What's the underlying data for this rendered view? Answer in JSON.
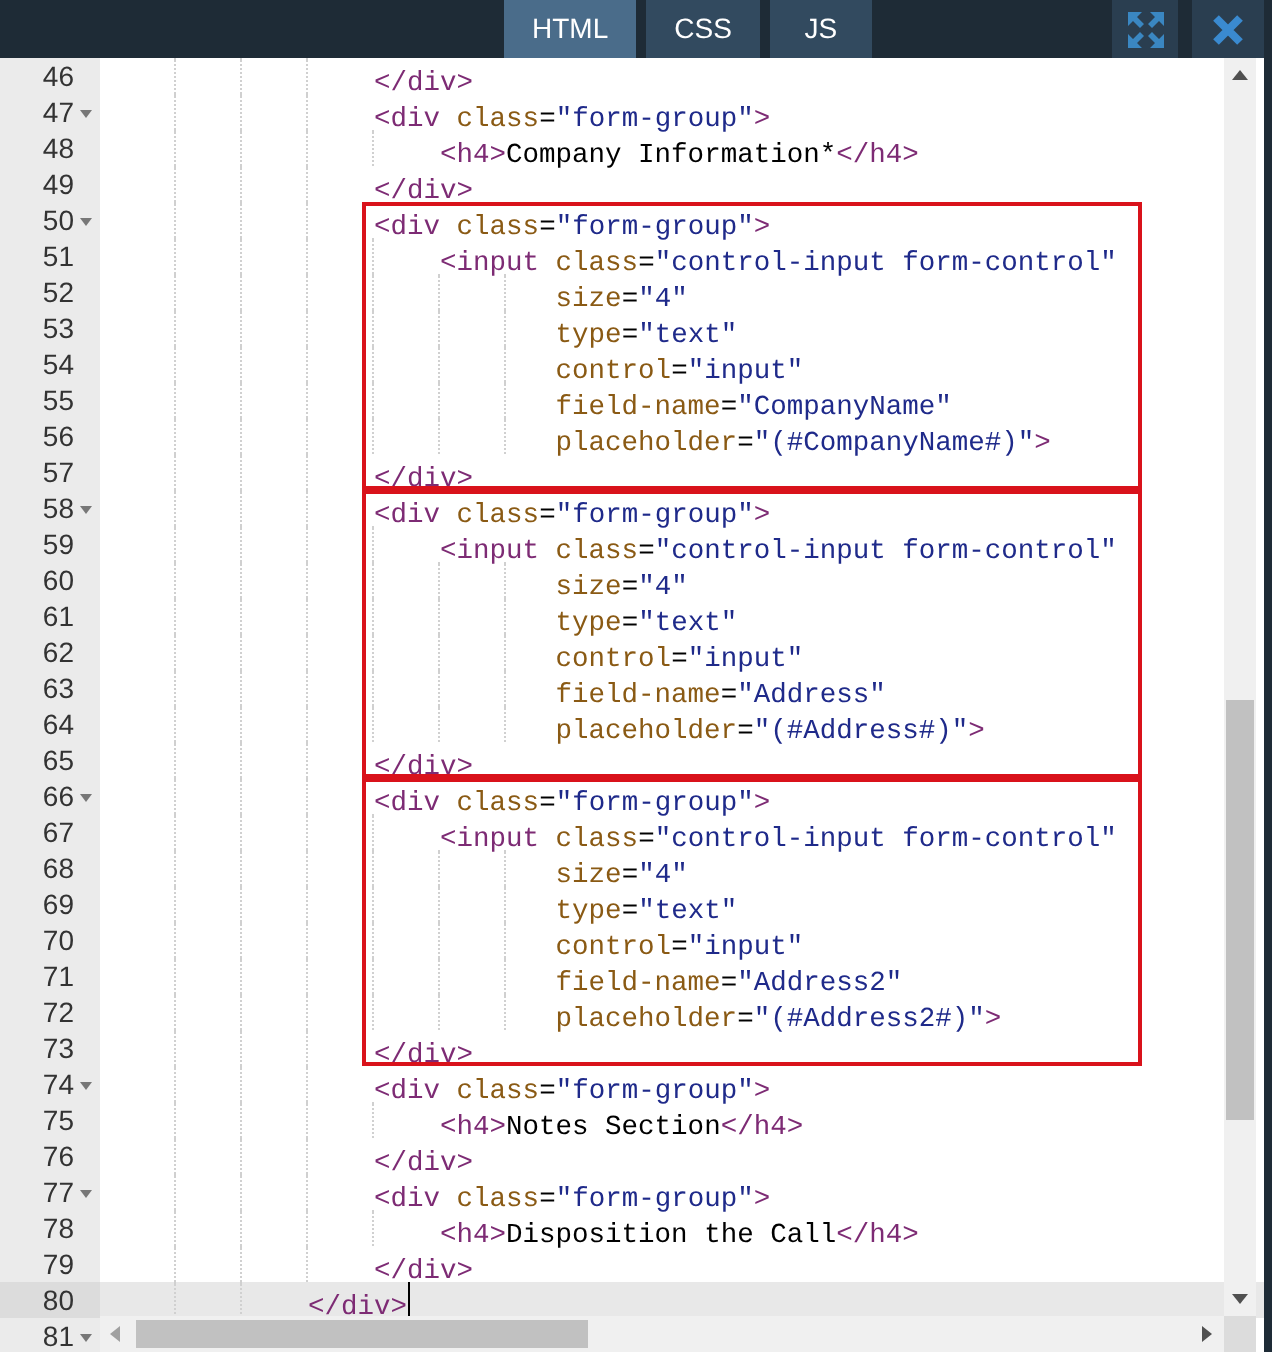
{
  "tabs": [
    {
      "label": "HTML",
      "selected": true
    },
    {
      "label": "CSS",
      "selected": false
    },
    {
      "label": "JS",
      "selected": false
    }
  ],
  "editor": {
    "blocks": [
      {
        "highlighted": false,
        "lines": [
          {
            "number": "46",
            "foldable": false,
            "active": false,
            "tokens": [
              {
                "kind": "tag",
                "text": "                </div>"
              }
            ]
          },
          {
            "number": "47",
            "foldable": true,
            "active": false,
            "tokens": [
              {
                "kind": "tag",
                "text": "                <div "
              },
              {
                "kind": "attr",
                "text": "class"
              },
              {
                "kind": "text",
                "text": "="
              },
              {
                "kind": "string",
                "text": "\"form-group\""
              },
              {
                "kind": "tag",
                "text": ">"
              }
            ]
          },
          {
            "number": "48",
            "foldable": false,
            "active": false,
            "tokens": [
              {
                "kind": "tag",
                "text": "                    <h4>"
              },
              {
                "kind": "text",
                "text": "Company Information*"
              },
              {
                "kind": "tag",
                "text": "</h4>"
              }
            ]
          },
          {
            "number": "49",
            "foldable": false,
            "active": false,
            "tokens": [
              {
                "kind": "tag",
                "text": "                </div>"
              }
            ]
          }
        ]
      },
      {
        "highlighted": true,
        "lines": [
          {
            "number": "50",
            "foldable": true,
            "active": false,
            "tokens": [
              {
                "kind": "tag",
                "text": "                <div "
              },
              {
                "kind": "attr",
                "text": "class"
              },
              {
                "kind": "text",
                "text": "="
              },
              {
                "kind": "string",
                "text": "\"form-group\""
              },
              {
                "kind": "tag",
                "text": ">"
              }
            ]
          },
          {
            "number": "51",
            "foldable": false,
            "active": false,
            "tokens": [
              {
                "kind": "tag",
                "text": "                    <input "
              },
              {
                "kind": "attr",
                "text": "class"
              },
              {
                "kind": "text",
                "text": "="
              },
              {
                "kind": "string",
                "text": "\"control-input form-control\""
              }
            ]
          },
          {
            "number": "52",
            "foldable": false,
            "active": false,
            "tokens": [
              {
                "kind": "attr",
                "text": "                           size"
              },
              {
                "kind": "text",
                "text": "="
              },
              {
                "kind": "string",
                "text": "\"4\""
              }
            ]
          },
          {
            "number": "53",
            "foldable": false,
            "active": false,
            "tokens": [
              {
                "kind": "attr",
                "text": "                           type"
              },
              {
                "kind": "text",
                "text": "="
              },
              {
                "kind": "string",
                "text": "\"text\""
              }
            ]
          },
          {
            "number": "54",
            "foldable": false,
            "active": false,
            "tokens": [
              {
                "kind": "attr",
                "text": "                           control"
              },
              {
                "kind": "text",
                "text": "="
              },
              {
                "kind": "string",
                "text": "\"input\""
              }
            ]
          },
          {
            "number": "55",
            "foldable": false,
            "active": false,
            "tokens": [
              {
                "kind": "attr",
                "text": "                           field-name"
              },
              {
                "kind": "text",
                "text": "="
              },
              {
                "kind": "string",
                "text": "\"CompanyName\""
              }
            ]
          },
          {
            "number": "56",
            "foldable": false,
            "active": false,
            "tokens": [
              {
                "kind": "attr",
                "text": "                           placeholder"
              },
              {
                "kind": "text",
                "text": "="
              },
              {
                "kind": "string",
                "text": "\"(#CompanyName#)\""
              },
              {
                "kind": "tag",
                "text": ">"
              }
            ]
          },
          {
            "number": "57",
            "foldable": false,
            "active": false,
            "tokens": [
              {
                "kind": "tag",
                "text": "                </div>"
              }
            ]
          }
        ]
      },
      {
        "highlighted": true,
        "lines": [
          {
            "number": "58",
            "foldable": true,
            "active": false,
            "tokens": [
              {
                "kind": "tag",
                "text": "                <div "
              },
              {
                "kind": "attr",
                "text": "class"
              },
              {
                "kind": "text",
                "text": "="
              },
              {
                "kind": "string",
                "text": "\"form-group\""
              },
              {
                "kind": "tag",
                "text": ">"
              }
            ]
          },
          {
            "number": "59",
            "foldable": false,
            "active": false,
            "tokens": [
              {
                "kind": "tag",
                "text": "                    <input "
              },
              {
                "kind": "attr",
                "text": "class"
              },
              {
                "kind": "text",
                "text": "="
              },
              {
                "kind": "string",
                "text": "\"control-input form-control\""
              }
            ]
          },
          {
            "number": "60",
            "foldable": false,
            "active": false,
            "tokens": [
              {
                "kind": "attr",
                "text": "                           size"
              },
              {
                "kind": "text",
                "text": "="
              },
              {
                "kind": "string",
                "text": "\"4\""
              }
            ]
          },
          {
            "number": "61",
            "foldable": false,
            "active": false,
            "tokens": [
              {
                "kind": "attr",
                "text": "                           type"
              },
              {
                "kind": "text",
                "text": "="
              },
              {
                "kind": "string",
                "text": "\"text\""
              }
            ]
          },
          {
            "number": "62",
            "foldable": false,
            "active": false,
            "tokens": [
              {
                "kind": "attr",
                "text": "                           control"
              },
              {
                "kind": "text",
                "text": "="
              },
              {
                "kind": "string",
                "text": "\"input\""
              }
            ]
          },
          {
            "number": "63",
            "foldable": false,
            "active": false,
            "tokens": [
              {
                "kind": "attr",
                "text": "                           field-name"
              },
              {
                "kind": "text",
                "text": "="
              },
              {
                "kind": "string",
                "text": "\"Address\""
              }
            ]
          },
          {
            "number": "64",
            "foldable": false,
            "active": false,
            "tokens": [
              {
                "kind": "attr",
                "text": "                           placeholder"
              },
              {
                "kind": "text",
                "text": "="
              },
              {
                "kind": "string",
                "text": "\"(#Address#)\""
              },
              {
                "kind": "tag",
                "text": ">"
              }
            ]
          },
          {
            "number": "65",
            "foldable": false,
            "active": false,
            "tokens": [
              {
                "kind": "tag",
                "text": "                </div>"
              }
            ]
          }
        ]
      },
      {
        "highlighted": true,
        "lines": [
          {
            "number": "66",
            "foldable": true,
            "active": false,
            "tokens": [
              {
                "kind": "tag",
                "text": "                <div "
              },
              {
                "kind": "attr",
                "text": "class"
              },
              {
                "kind": "text",
                "text": "="
              },
              {
                "kind": "string",
                "text": "\"form-group\""
              },
              {
                "kind": "tag",
                "text": ">"
              }
            ]
          },
          {
            "number": "67",
            "foldable": false,
            "active": false,
            "tokens": [
              {
                "kind": "tag",
                "text": "                    <input "
              },
              {
                "kind": "attr",
                "text": "class"
              },
              {
                "kind": "text",
                "text": "="
              },
              {
                "kind": "string",
                "text": "\"control-input form-control\""
              }
            ]
          },
          {
            "number": "68",
            "foldable": false,
            "active": false,
            "tokens": [
              {
                "kind": "attr",
                "text": "                           size"
              },
              {
                "kind": "text",
                "text": "="
              },
              {
                "kind": "string",
                "text": "\"4\""
              }
            ]
          },
          {
            "number": "69",
            "foldable": false,
            "active": false,
            "tokens": [
              {
                "kind": "attr",
                "text": "                           type"
              },
              {
                "kind": "text",
                "text": "="
              },
              {
                "kind": "string",
                "text": "\"text\""
              }
            ]
          },
          {
            "number": "70",
            "foldable": false,
            "active": false,
            "tokens": [
              {
                "kind": "attr",
                "text": "                           control"
              },
              {
                "kind": "text",
                "text": "="
              },
              {
                "kind": "string",
                "text": "\"input\""
              }
            ]
          },
          {
            "number": "71",
            "foldable": false,
            "active": false,
            "tokens": [
              {
                "kind": "attr",
                "text": "                           field-name"
              },
              {
                "kind": "text",
                "text": "="
              },
              {
                "kind": "string",
                "text": "\"Address2\""
              }
            ]
          },
          {
            "number": "72",
            "foldable": false,
            "active": false,
            "tokens": [
              {
                "kind": "attr",
                "text": "                           placeholder"
              },
              {
                "kind": "text",
                "text": "="
              },
              {
                "kind": "string",
                "text": "\"(#Address2#)\""
              },
              {
                "kind": "tag",
                "text": ">"
              }
            ]
          },
          {
            "number": "73",
            "foldable": false,
            "active": false,
            "tokens": [
              {
                "kind": "tag",
                "text": "                </div>"
              }
            ]
          }
        ]
      },
      {
        "highlighted": false,
        "lines": [
          {
            "number": "74",
            "foldable": true,
            "active": false,
            "tokens": [
              {
                "kind": "tag",
                "text": "                <div "
              },
              {
                "kind": "attr",
                "text": "class"
              },
              {
                "kind": "text",
                "text": "="
              },
              {
                "kind": "string",
                "text": "\"form-group\""
              },
              {
                "kind": "tag",
                "text": ">"
              }
            ]
          },
          {
            "number": "75",
            "foldable": false,
            "active": false,
            "tokens": [
              {
                "kind": "tag",
                "text": "                    <h4>"
              },
              {
                "kind": "text",
                "text": "Notes Section"
              },
              {
                "kind": "tag",
                "text": "</h4>"
              }
            ]
          },
          {
            "number": "76",
            "foldable": false,
            "active": false,
            "tokens": [
              {
                "kind": "tag",
                "text": "                </div>"
              }
            ]
          },
          {
            "number": "77",
            "foldable": true,
            "active": false,
            "tokens": [
              {
                "kind": "tag",
                "text": "                <div "
              },
              {
                "kind": "attr",
                "text": "class"
              },
              {
                "kind": "text",
                "text": "="
              },
              {
                "kind": "string",
                "text": "\"form-group\""
              },
              {
                "kind": "tag",
                "text": ">"
              }
            ]
          },
          {
            "number": "78",
            "foldable": false,
            "active": false,
            "tokens": [
              {
                "kind": "tag",
                "text": "                    <h4>"
              },
              {
                "kind": "text",
                "text": "Disposition the Call"
              },
              {
                "kind": "tag",
                "text": "</h4>"
              }
            ]
          },
          {
            "number": "79",
            "foldable": false,
            "active": false,
            "tokens": [
              {
                "kind": "tag",
                "text": "                </div>"
              }
            ]
          },
          {
            "number": "80",
            "foldable": false,
            "active": true,
            "tokens": [
              {
                "kind": "tag",
                "text": "            </div>"
              }
            ]
          },
          {
            "number": "81",
            "foldable": true,
            "active": false
          }
        ]
      }
    ]
  }
}
